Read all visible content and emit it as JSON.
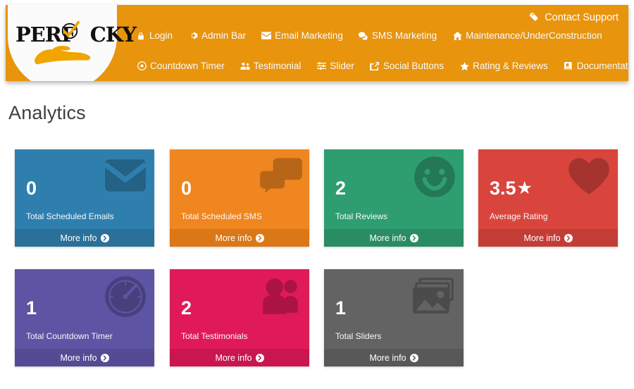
{
  "brand": {
    "name_part1": "PERF",
    "name_part2": "CKY",
    "full_name": "PERFECKY",
    "logo_icon": "clock-check-on-hand-icon"
  },
  "header": {
    "support_link": {
      "label": "Contact Support",
      "icon": "tag-icon"
    },
    "nav_row1": [
      {
        "label": "Login",
        "icon": "lock-icon"
      },
      {
        "label": "Admin Bar",
        "icon": "gear-icon"
      },
      {
        "label": "Email Marketing",
        "icon": "envelope-icon"
      },
      {
        "label": "SMS Marketing",
        "icon": "comments-icon"
      },
      {
        "label": "Maintenance/UnderConstruction",
        "icon": "home-icon"
      }
    ],
    "nav_row2": [
      {
        "label": "Countdown Timer",
        "icon": "clock-icon"
      },
      {
        "label": "Testimonial",
        "icon": "users-group-icon"
      },
      {
        "label": "Slider",
        "icon": "sliders-icon"
      },
      {
        "label": "Social Buttons",
        "icon": "share-square-icon"
      },
      {
        "label": "Rating & Reviews",
        "icon": "star-icon"
      },
      {
        "label": "Documentation",
        "icon": "book-icon"
      }
    ]
  },
  "main": {
    "title": "Analytics",
    "more_info_label": "More info",
    "more_info_icon": "circle-arrow-right-icon",
    "cards": [
      {
        "value": "0",
        "suffix": "",
        "label": "Total Scheduled Emails",
        "icon": "envelope-icon",
        "color": "#2f7fae",
        "footer_color": "#2a7099"
      },
      {
        "value": "0",
        "suffix": "",
        "label": "Total Scheduled SMS",
        "icon": "comments-icon",
        "color": "#f0861f",
        "footer_color": "#db7717"
      },
      {
        "value": "2",
        "suffix": "",
        "label": "Total Reviews",
        "icon": "smile-icon",
        "color": "#2e9e70",
        "footer_color": "#298c63"
      },
      {
        "value": "3.5",
        "suffix": "★",
        "label": "Average Rating",
        "icon": "heart-icon",
        "color": "#d9453d",
        "footer_color": "#c23d36"
      },
      {
        "value": "1",
        "suffix": "",
        "label": "Total Countdown Timer",
        "icon": "speedometer-icon",
        "color": "#5d54a4",
        "footer_color": "#544b94"
      },
      {
        "value": "2",
        "suffix": "",
        "label": "Total Testimonials",
        "icon": "users-group-icon",
        "color": "#e01a59",
        "footer_color": "#c9164f"
      },
      {
        "value": "1",
        "suffix": "",
        "label": "Total Sliders",
        "icon": "images-icon",
        "color": "#636363",
        "footer_color": "#585858"
      }
    ]
  },
  "theme": {
    "header_bg": "#e8940d",
    "page_bg": "#ffffff",
    "title_color": "#3c4043"
  }
}
